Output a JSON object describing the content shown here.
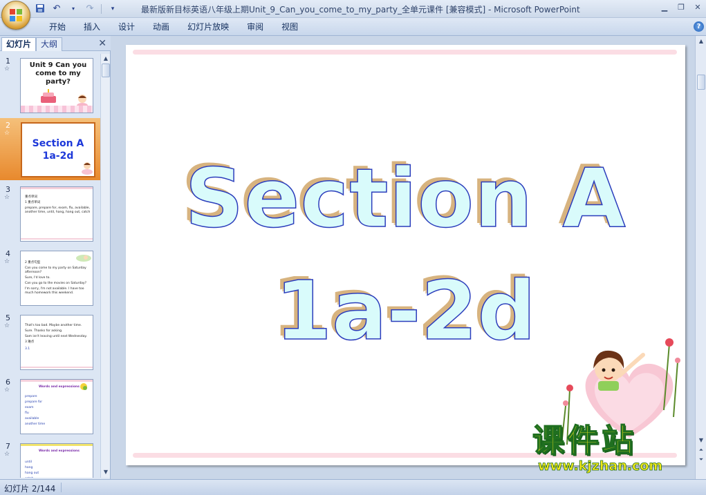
{
  "window": {
    "title": "最新版新目标英语八年级上期Unit_9_Can_you_come_to_my_party_全单元课件 [兼容模式] - Microsoft PowerPoint"
  },
  "ribbon": {
    "tabs": [
      "开始",
      "插入",
      "设计",
      "动画",
      "幻灯片放映",
      "审阅",
      "视图"
    ]
  },
  "left_pane": {
    "tab_slides": "幻灯片",
    "tab_outline": "大纲",
    "slides": [
      {
        "num": "1",
        "title": "Unit 9 Can you come to my party?"
      },
      {
        "num": "2",
        "line1": "Section A",
        "line2": "1a-2d",
        "selected": true
      },
      {
        "num": "3",
        "lines": [
          "重点单词",
          "1 重点单词",
          "prepare, prepare for, exam, flu, available, another time, until, hang, hang out, catch"
        ]
      },
      {
        "num": "4",
        "lines": [
          "2 重点句型",
          "Can you come to my party on Saturday afternoon?",
          "Sure, I'd love to.",
          "Can you go to the movies on Saturday?",
          "I'm sorry, I'm not available. I have too much homework this weekend."
        ]
      },
      {
        "num": "5",
        "lines": [
          "That's too bad. Maybe another time.",
          "Sure. Thanks for asking.",
          "Sam isn't leaving until next Wednesday.",
          "3 难点",
          "3.1"
        ]
      },
      {
        "num": "6",
        "heading": "Words and expressions",
        "lines": [
          "prepare",
          "prepare for",
          "exam",
          "flu",
          "available",
          "another time"
        ]
      },
      {
        "num": "7",
        "heading": "Words and expressions",
        "lines": [
          "until",
          "hang",
          "hang out",
          "catch"
        ]
      }
    ]
  },
  "slide": {
    "line1": "Section A",
    "line2": "1a-2d"
  },
  "watermark": {
    "brand": "课件站",
    "url": "www.kjzhan.com"
  },
  "status": {
    "slide_counter": "幻灯片 2/144"
  },
  "colors": {
    "accent_selected": "#e8892d",
    "title_text_fill": "#d9fbfb",
    "title_text_stroke": "#2b3dbc",
    "title_shadow": "#d7b37f",
    "watermark_yellow": "#f6e91a"
  }
}
